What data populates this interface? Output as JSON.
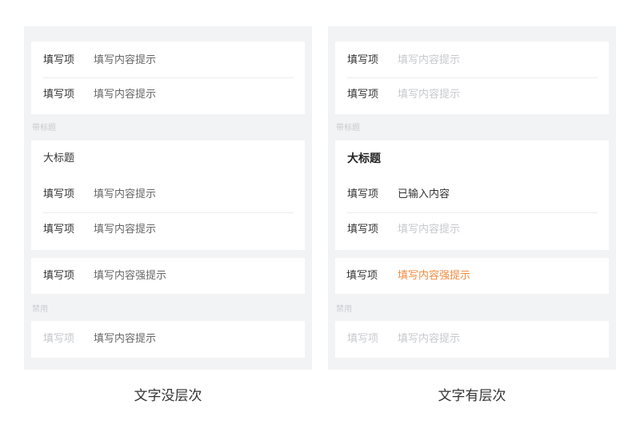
{
  "left": {
    "group1": [
      {
        "label": "填写项",
        "value": "填写内容提示"
      },
      {
        "label": "填写项",
        "value": "填写内容提示"
      }
    ],
    "section_titled": "带标题",
    "group2_title": "大标题",
    "group2": [
      {
        "label": "填写项",
        "value": "填写内容提示"
      },
      {
        "label": "填写项",
        "value": "填写内容提示"
      }
    ],
    "strong_row": {
      "label": "填写项",
      "value": "填写内容强提示"
    },
    "section_disabled": "禁用",
    "disabled_row": {
      "label": "填写项",
      "value": "填写内容提示"
    }
  },
  "right": {
    "group1": [
      {
        "label": "填写项",
        "value": "填写内容提示"
      },
      {
        "label": "填写项",
        "value": "填写内容提示"
      }
    ],
    "section_titled": "带标题",
    "group2_title": "大标题",
    "group2": [
      {
        "label": "填写项",
        "value": "已输入内容"
      },
      {
        "label": "填写项",
        "value": "填写内容提示"
      }
    ],
    "strong_row": {
      "label": "填写项",
      "value": "填写内容强提示"
    },
    "section_disabled": "禁用",
    "disabled_row": {
      "label": "填写项",
      "value": "填写内容提示"
    }
  },
  "captions": {
    "left": "文字没层次",
    "right": "文字有层次"
  },
  "colors": {
    "panel_bg": "#f2f3f5",
    "strong_hint": "#f28a3c",
    "placeholder": "#c7c9cd"
  }
}
